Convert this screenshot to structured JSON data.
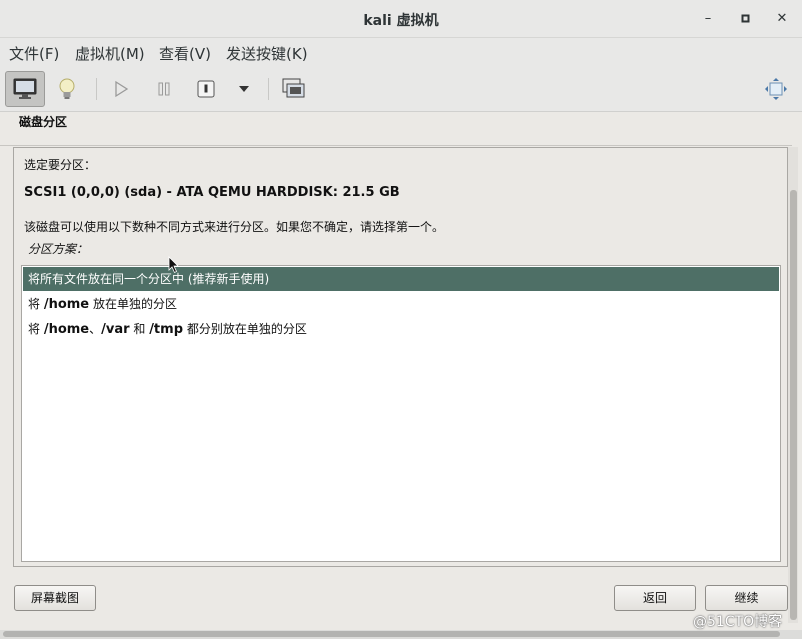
{
  "window": {
    "title": "kali 虚拟机",
    "minimize_glyph": "–",
    "maximize_glyph": "▪",
    "close_glyph": "✕"
  },
  "menu": [
    {
      "label": "文件(F)"
    },
    {
      "label": "虚拟机(M)"
    },
    {
      "label": "查看(V)"
    },
    {
      "label": "发送按键(K)"
    }
  ],
  "toolbar": {
    "icons": [
      "monitor-icon",
      "lightbulb-icon",
      "play-icon",
      "pause-icon",
      "power-icon",
      "dropdown-icon",
      "screenshot-icon",
      "fullscreen-icon"
    ]
  },
  "installer": {
    "heading": "磁盘分区",
    "select_label": "选定要分区：",
    "disk": "SCSI1 (0,0,0) (sda) - ATA QEMU HARDDISK: 21.5 GB",
    "description": "该磁盘可以使用以下数种不同方式来进行分区。如果您不确定，请选择第一个。",
    "scheme_label": "分区方案：",
    "options": [
      {
        "prefix": "将所有文件放在同一个分区中 (推荐新手使用)",
        "bold": "",
        "suffix": "",
        "selected": true
      },
      {
        "prefix": "将 ",
        "bold": "/home",
        "suffix": " 放在单独的分区",
        "selected": false
      },
      {
        "prefix": "将 ",
        "bold": "/home",
        "mid": "、",
        "bold2": "/var",
        "mid2": " 和 ",
        "bold3": "/tmp",
        "suffix": " 都分别放在单独的分区",
        "selected": false
      }
    ],
    "screenshot_button": "屏幕截图",
    "back_button": "返回",
    "continue_button": "继续"
  },
  "watermark": "@51CTO博客"
}
